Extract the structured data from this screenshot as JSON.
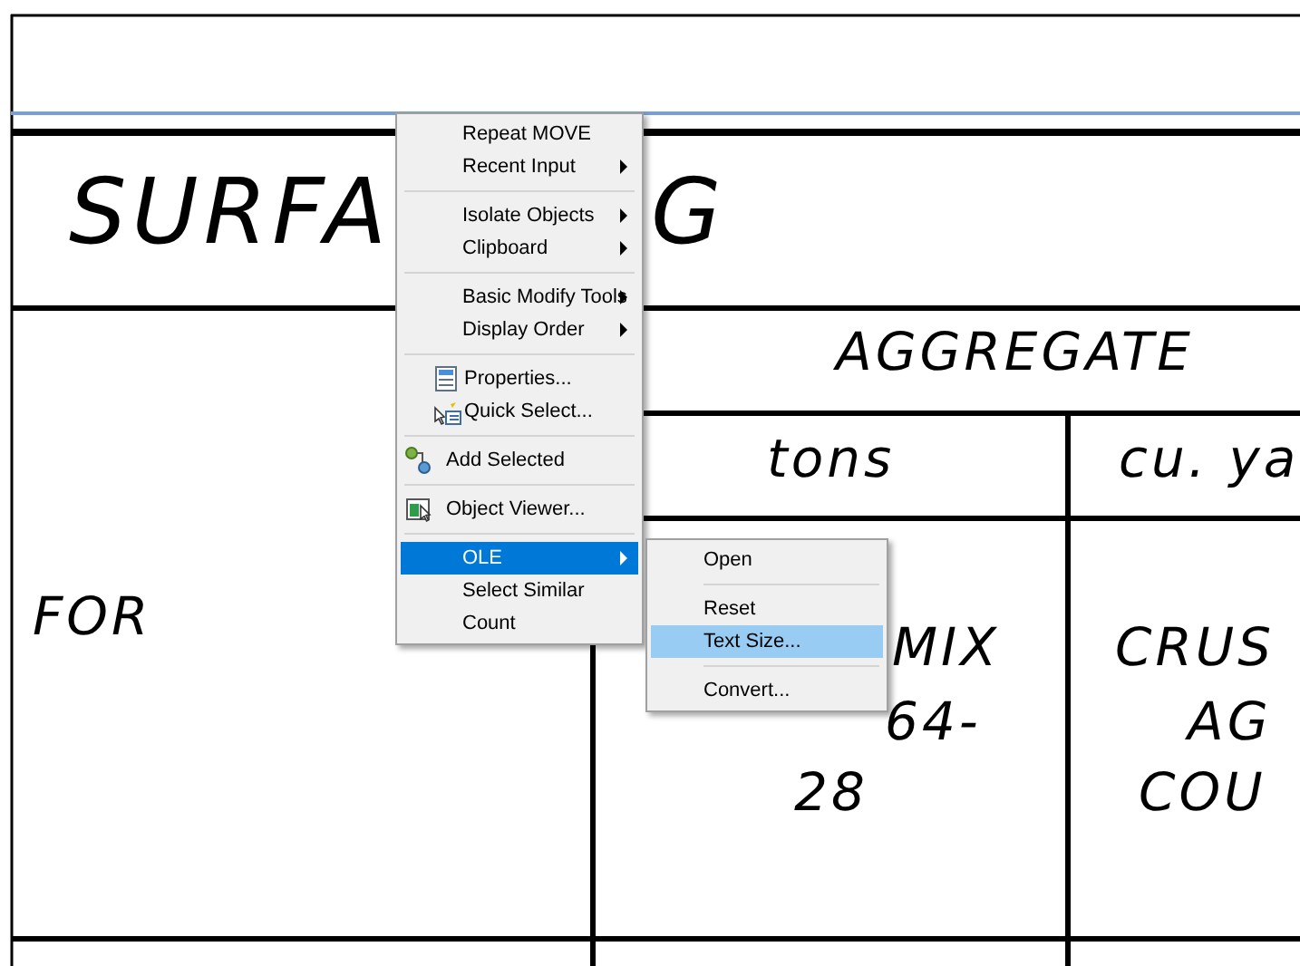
{
  "drawing": {
    "texts": [
      {
        "kind": "title",
        "text": "SURFA"
      },
      {
        "kind": "title",
        "text": "G"
      },
      {
        "kind": "heading",
        "text": "AGGREGATE"
      },
      {
        "kind": "heading",
        "text": "tons"
      },
      {
        "kind": "heading",
        "text": "cu. ya"
      },
      {
        "kind": "heading",
        "text": "FOR"
      },
      {
        "kind": "heading",
        "text": "MIX"
      },
      {
        "kind": "heading",
        "text": "64-"
      },
      {
        "kind": "heading",
        "text": "28"
      },
      {
        "kind": "heading",
        "text": "CRUS"
      },
      {
        "kind": "heading",
        "text": "AG"
      },
      {
        "kind": "heading",
        "text": "COU"
      }
    ]
  },
  "context_menu": {
    "sections": [
      [
        {
          "label": "Repeat MOVE",
          "submenu": false,
          "selected": false
        },
        {
          "label": "Recent Input",
          "submenu": true,
          "selected": false
        }
      ],
      [
        {
          "label": "Isolate Objects",
          "submenu": true,
          "selected": false
        },
        {
          "label": "Clipboard",
          "submenu": true,
          "selected": false
        }
      ],
      [
        {
          "label": "Basic Modify Tools",
          "submenu": true,
          "selected": false
        },
        {
          "label": "Display Order",
          "submenu": true,
          "selected": false
        }
      ],
      [
        {
          "label": "Properties...",
          "submenu": false,
          "selected": false
        },
        {
          "label": "Quick Select...",
          "submenu": false,
          "selected": false
        }
      ],
      [
        {
          "label": "Add Selected",
          "submenu": false,
          "selected": false
        }
      ],
      [
        {
          "label": "Object Viewer...",
          "submenu": false,
          "selected": false
        }
      ],
      [
        {
          "label": "OLE",
          "submenu": true,
          "selected": true
        },
        {
          "label": "Select Similar",
          "submenu": false,
          "selected": false
        },
        {
          "label": "Count",
          "submenu": false,
          "selected": false
        }
      ]
    ]
  },
  "submenu": {
    "sections": [
      [
        {
          "label": "Open",
          "selected": false
        }
      ],
      [
        {
          "label": "Reset",
          "selected": false
        },
        {
          "label": "Text Size...",
          "selected": true
        }
      ],
      [
        {
          "label": "Convert...",
          "selected": false
        }
      ]
    ]
  }
}
